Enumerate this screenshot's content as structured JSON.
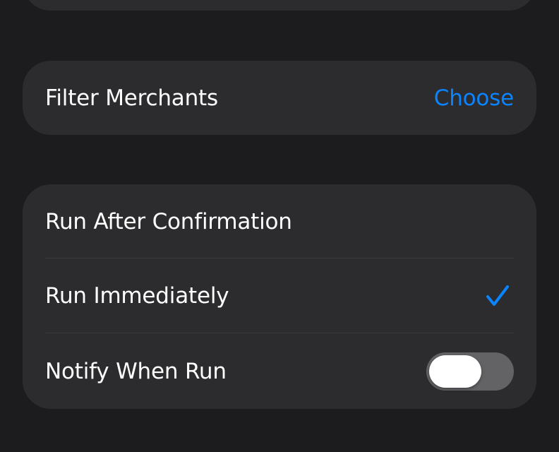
{
  "filter": {
    "label": "Filter Merchants",
    "value": "Choose"
  },
  "run_options": {
    "items": [
      {
        "label": "Run After Confirmation",
        "selected": false
      },
      {
        "label": "Run Immediately",
        "selected": true
      }
    ],
    "notify": {
      "label": "Notify When Run",
      "enabled": false
    }
  },
  "icons": {
    "checkmark": "checkmark-icon"
  },
  "colors": {
    "background": "#1c1c1e",
    "card": "#2c2c2e",
    "accent": "#0a84ff",
    "toggle_off": "#636366"
  }
}
